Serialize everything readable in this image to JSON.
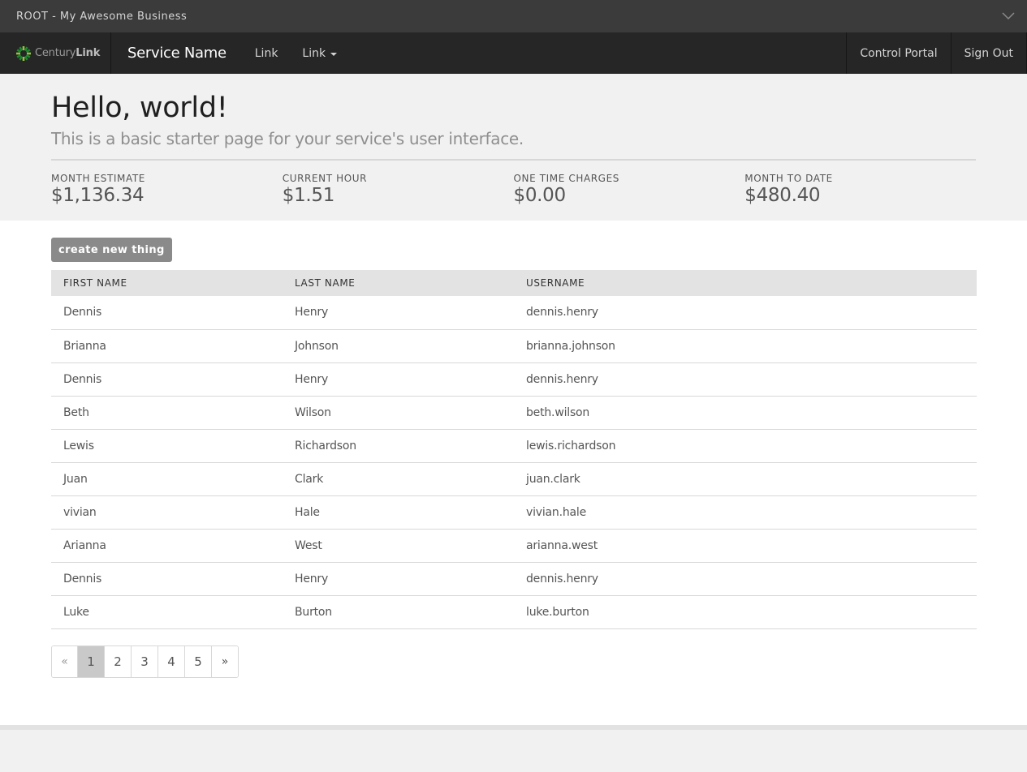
{
  "topbar": {
    "account_name": "ROOT - My Awesome Business",
    "toggle_icon": "chevron-down-icon"
  },
  "navbar": {
    "logo": {
      "text_regular": "Century",
      "text_bold": "Link",
      "icon": "centurylink-burst-logo",
      "colors": {
        "dark_green": "#1e8a2e",
        "light_green": "#8dc63f"
      }
    },
    "service_name": "Service Name",
    "links": [
      {
        "label": "Link",
        "dropdown": false
      },
      {
        "label": "Link",
        "dropdown": true
      }
    ],
    "right_links": [
      {
        "label": "Control Portal"
      },
      {
        "label": "Sign Out"
      }
    ]
  },
  "jumbotron": {
    "title": "Hello, world!",
    "lead": "This is a basic starter page for your service's user interface.",
    "stats": [
      {
        "label": "MONTH ESTIMATE",
        "value": "$1,136.34"
      },
      {
        "label": "CURRENT HOUR",
        "value": "$1.51"
      },
      {
        "label": "ONE TIME CHARGES",
        "value": "$0.00"
      },
      {
        "label": "MONTH TO DATE",
        "value": "$480.40"
      }
    ]
  },
  "content": {
    "create_button": "create new thing",
    "table": {
      "headers": [
        "FIRST NAME",
        "LAST NAME",
        "USERNAME"
      ],
      "rows": [
        [
          "Dennis",
          "Henry",
          "dennis.henry"
        ],
        [
          "Brianna",
          "Johnson",
          "brianna.johnson"
        ],
        [
          "Dennis",
          "Henry",
          "dennis.henry"
        ],
        [
          "Beth",
          "Wilson",
          "beth.wilson"
        ],
        [
          "Lewis",
          "Richardson",
          "lewis.richardson"
        ],
        [
          "Juan",
          "Clark",
          "juan.clark"
        ],
        [
          "vivian",
          "Hale",
          "vivian.hale"
        ],
        [
          "Arianna",
          "West",
          "arianna.west"
        ],
        [
          "Dennis",
          "Henry",
          "dennis.henry"
        ],
        [
          "Luke",
          "Burton",
          "luke.burton"
        ]
      ]
    },
    "pagination": {
      "prev": "«",
      "next": "»",
      "pages": [
        "1",
        "2",
        "3",
        "4",
        "5"
      ],
      "active_page": "1"
    }
  }
}
